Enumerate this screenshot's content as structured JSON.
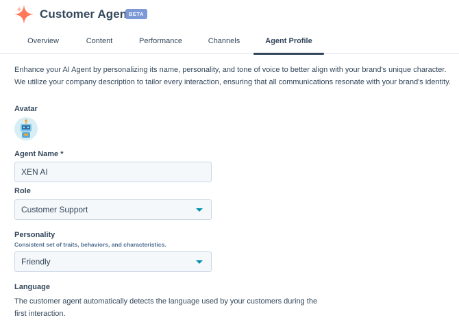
{
  "app": {
    "title": "Customer Agent",
    "badge": "BETA",
    "brand_color": "#ff7a59"
  },
  "tabs": [
    {
      "label": "Overview",
      "active": false
    },
    {
      "label": "Content",
      "active": false
    },
    {
      "label": "Performance",
      "active": false
    },
    {
      "label": "Channels",
      "active": false
    },
    {
      "label": "Agent Profile",
      "active": true
    }
  ],
  "intro": "Enhance your AI Agent by personalizing its name, personality, and tone of voice to better align with your brand's unique character. We utilize your company description to tailor every interaction, ensuring that all communications resonate with your brand's identity.",
  "avatar": {
    "label": "Avatar",
    "icon": "robot-avatar-icon"
  },
  "agent_name": {
    "label": "Agent Name *",
    "value": "XEN AI"
  },
  "role": {
    "label": "Role",
    "value": "Customer Support"
  },
  "personality": {
    "label": "Personality",
    "help": "Consistent set of traits, behaviors, and characteristics.",
    "value": "Friendly"
  },
  "language": {
    "label": "Language",
    "description": "The customer agent automatically detects the language used by your customers during the first interaction."
  },
  "colors": {
    "text": "#33475b",
    "caret": "#0091ae",
    "badge": "#7c98d6",
    "field_bg": "#f5f8fa",
    "border": "#cbd6e2"
  }
}
